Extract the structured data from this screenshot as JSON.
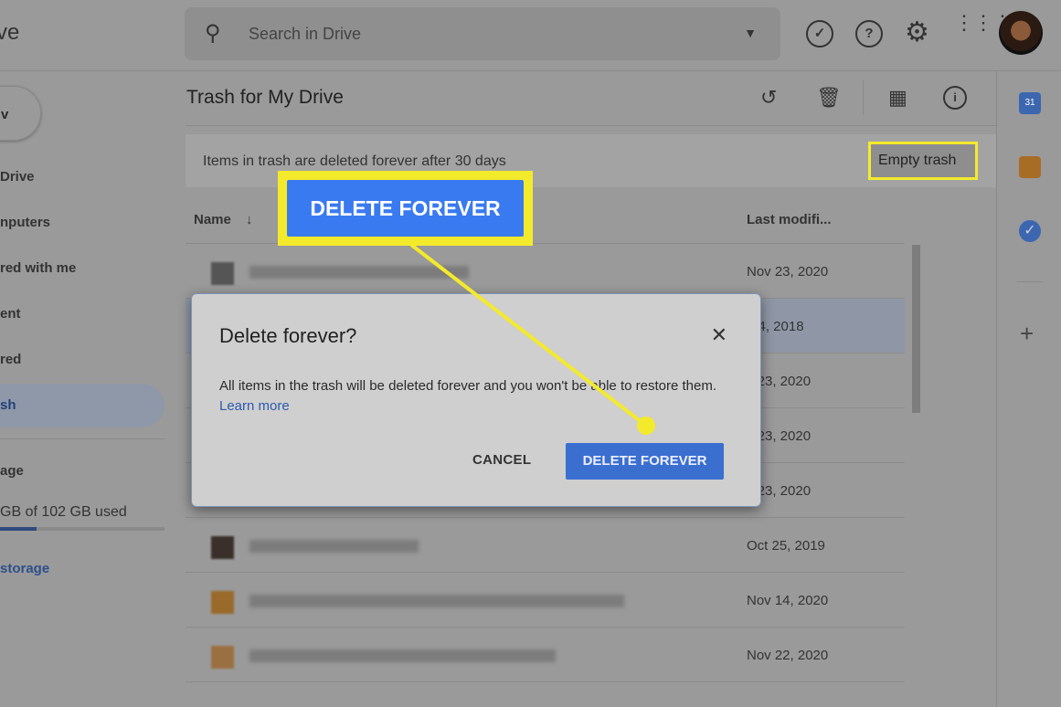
{
  "header": {
    "logo_partial": "ve",
    "search_placeholder": "Search in Drive",
    "icons": [
      "search-icon",
      "dropdown-icon",
      "ready-offline-icon",
      "help-icon",
      "settings-icon",
      "apps-icon",
      "avatar"
    ]
  },
  "sidebar": {
    "new_label": "v",
    "items": [
      "Drive",
      "nputers",
      "red with me",
      "ent",
      "red",
      "sh"
    ],
    "storage_label": "age",
    "storage_text": "GB of 102 GB used",
    "storage_used_fraction": 0.22,
    "buy_storage": "storage"
  },
  "main": {
    "title": "Trash for My Drive",
    "banner": "Items in trash are deleted forever after 30 days",
    "empty_trash": "Empty trash",
    "col_name": "Name",
    "col_modified": "Last modifi...",
    "rows": [
      {
        "date": "Nov 23, 2020",
        "thumb": "#555"
      },
      {
        "date": "n 4, 2018",
        "thumb": "#888"
      },
      {
        "date": "v 23, 2020",
        "thumb": "#888"
      },
      {
        "date": "v 23, 2020",
        "thumb": "#888"
      },
      {
        "date": "v 23, 2020",
        "thumb": "#888"
      },
      {
        "date": "Oct 25, 2019",
        "thumb": "#3a2f2a"
      },
      {
        "date": "Nov 14, 2020",
        "thumb": "#9a6a2a"
      },
      {
        "date": "Nov 22, 2020",
        "thumb": "#9a7040"
      }
    ]
  },
  "dialog": {
    "title": "Delete forever?",
    "body": "All items in the trash will be deleted forever and you won't be able to restore them.",
    "learn_more": "Learn more",
    "cancel": "CANCEL",
    "confirm": "DELETE FOREVER"
  },
  "callout": {
    "label": "DELETE FOREVER",
    "highlight_color": "#f4ea2c"
  }
}
